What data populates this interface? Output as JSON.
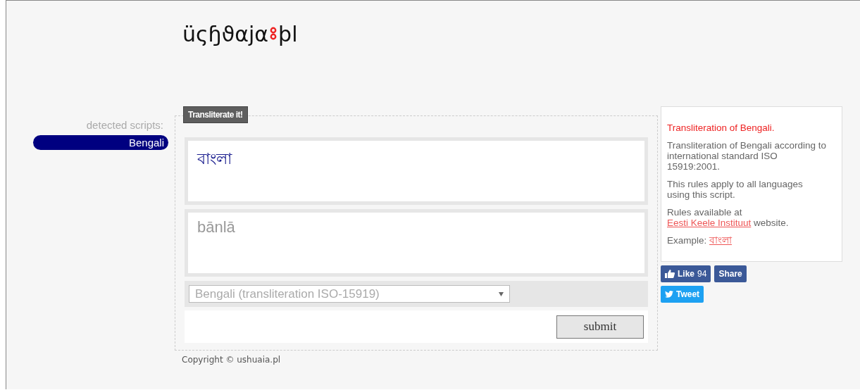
{
  "logo": {
    "main": "üςɧϑαjα",
    "suffix": "þl"
  },
  "sidebar": {
    "label": "detected scripts:",
    "scripts": [
      {
        "name": "Bengali",
        "selected": true
      }
    ]
  },
  "form": {
    "tab": "Transliterate it!",
    "input": "বাংলা",
    "output": "bānlā",
    "select": "Bengali (transliteration ISO-15919)",
    "submit": "submit"
  },
  "info": {
    "title": "Transliteration of Bengali.",
    "paragraphs": [
      "Transliteration of Bengali according to international standard ISO 15919:2001.",
      "This rules apply to all languages using this script."
    ],
    "rules_before": "Rules available at ",
    "rules_link": "Eesti Keele Instituut",
    "rules_after": " website.",
    "example_label": "Example: ",
    "example_link": "বাংলা"
  },
  "social": {
    "like": "Like",
    "like_count": "94",
    "share": "Share",
    "tweet": "Tweet"
  },
  "footer": "Copyright © ushuaia.pl"
}
